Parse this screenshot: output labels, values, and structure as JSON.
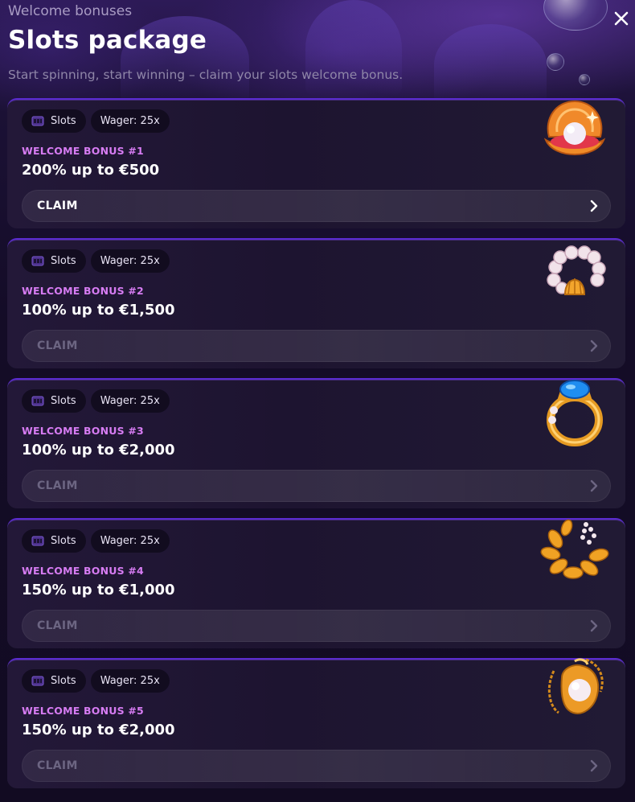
{
  "header": {
    "kicker": "Welcome bonuses",
    "title": "Slots package",
    "subtitle": "Start spinning, start winning – claim your slots welcome bonus."
  },
  "close_icon": "close-icon",
  "chip_icon": "slot-machine-icon",
  "colors": {
    "accent_border": "#5b2bd1",
    "bonus_label": "#d77cf3",
    "background": "#140d26"
  },
  "bonuses": [
    {
      "category": "Slots",
      "wager": "Wager: 25x",
      "label": "WELCOME BONUS #1",
      "offer": "200% up to €500",
      "claim": "CLAIM",
      "enabled": true,
      "artwork": "pearl-shell-icon"
    },
    {
      "category": "Slots",
      "wager": "Wager: 25x",
      "label": "WELCOME BONUS #2",
      "offer": "100% up to €1,500",
      "claim": "CLAIM",
      "enabled": false,
      "artwork": "pearl-bracelet-icon"
    },
    {
      "category": "Slots",
      "wager": "Wager: 25x",
      "label": "WELCOME BONUS #3",
      "offer": "100% up to €2,000",
      "claim": "CLAIM",
      "enabled": false,
      "artwork": "sapphire-ring-icon"
    },
    {
      "category": "Slots",
      "wager": "Wager: 25x",
      "label": "WELCOME BONUS #4",
      "offer": "150% up to €1,000",
      "claim": "CLAIM",
      "enabled": false,
      "artwork": "golden-wreath-icon"
    },
    {
      "category": "Slots",
      "wager": "Wager: 25x",
      "label": "WELCOME BONUS #5",
      "offer": "150% up to €2,000",
      "claim": "CLAIM",
      "enabled": false,
      "artwork": "pearl-amulet-icon"
    }
  ]
}
